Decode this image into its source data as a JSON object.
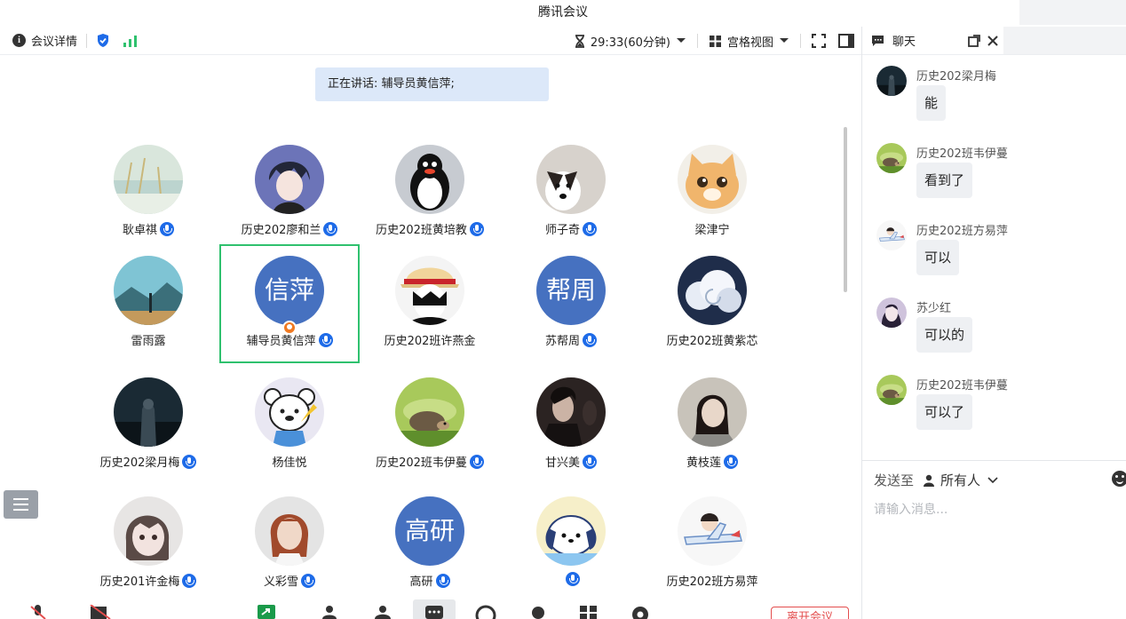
{
  "window": {
    "title": "腾讯会议"
  },
  "topbar": {
    "meeting_info_label": "会议详情",
    "timer": "29:33(60分钟)",
    "view_label": "宫格视图"
  },
  "speaking": {
    "label": "正在讲话: 辅导员黄信萍;"
  },
  "participants": [
    {
      "name": "耿卓祺",
      "avatar": "lake-photo",
      "mic": true
    },
    {
      "name": "历史202廖和兰",
      "avatar": "anime-boy",
      "mic": true
    },
    {
      "name": "历史202班黄培教",
      "avatar": "penguin",
      "mic": true
    },
    {
      "name": "师子奇",
      "avatar": "dog",
      "mic": true
    },
    {
      "name": "梁津宁",
      "avatar": "cat",
      "mic": false
    },
    {
      "name": "雷雨露",
      "avatar": "landscape",
      "mic": false
    },
    {
      "name": "辅导员黄信萍",
      "avatar_text": "信萍",
      "mic": true,
      "host": true,
      "active": true
    },
    {
      "name": "历史202班许燕金",
      "avatar": "straw-hat",
      "mic": false
    },
    {
      "name": "苏帮周",
      "avatar_text": "帮周",
      "mic": true
    },
    {
      "name": "历史202班黄紫芯",
      "avatar": "clouds",
      "mic": false
    },
    {
      "name": "历史202梁月梅",
      "avatar": "dark-figure",
      "mic": true
    },
    {
      "name": "杨佳悦",
      "avatar": "bear",
      "mic": false
    },
    {
      "name": "历史202班韦伊蔓",
      "avatar": "hedgehog",
      "mic": true
    },
    {
      "name": "甘兴美",
      "avatar": "dark-portrait",
      "mic": true
    },
    {
      "name": "黄枝莲",
      "avatar": "girl-photo",
      "mic": true
    },
    {
      "name": "历史201许金梅",
      "avatar": "anime-girl",
      "mic": true
    },
    {
      "name": "义彩雪",
      "avatar": "woman-red-hair",
      "mic": true
    },
    {
      "name": "高研",
      "avatar_text": "高研",
      "mic": true
    },
    {
      "name": "",
      "avatar": "pochacco",
      "mic": true
    },
    {
      "name": "历史202班方易萍",
      "avatar": "plane-boy",
      "mic": false
    }
  ],
  "chat": {
    "title": "聊天",
    "messages": [
      {
        "sender": "历史202梁月梅",
        "text": "能",
        "avatar": "dark-figure"
      },
      {
        "sender": "历史202班韦伊蔓",
        "text": "看到了",
        "avatar": "hedgehog"
      },
      {
        "sender": "历史202班方易萍",
        "text": "可以",
        "avatar": "plane-boy"
      },
      {
        "sender": "苏少红",
        "text": "可以的",
        "avatar": "purple-girl"
      },
      {
        "sender": "历史202班韦伊蔓",
        "text": "可以了",
        "avatar": "hedgehog"
      }
    ],
    "send_to_label": "发送至",
    "send_to_value": "所有人",
    "input_placeholder": "请输入消息..."
  },
  "bottombar": {
    "leave_label": "离开会议"
  },
  "colors": {
    "accent": "#1e6be8",
    "speaker_bg": "#dce8f9",
    "active_border": "#2fc16e",
    "text_avatar": "#4671c0",
    "leave_red": "#e34d4d"
  }
}
